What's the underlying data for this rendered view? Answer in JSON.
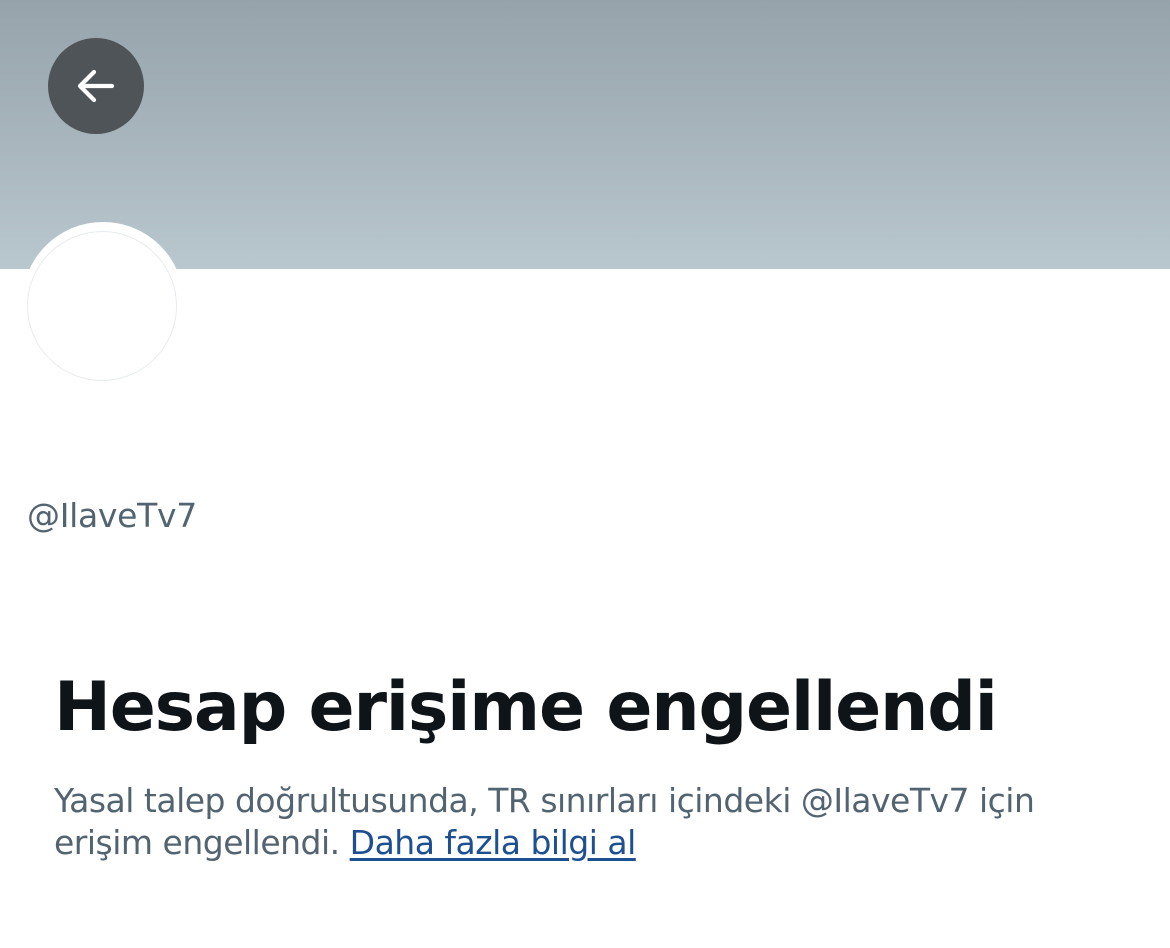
{
  "header": {
    "back_icon": "arrow-left-icon",
    "banner_color": "#a9b6be"
  },
  "profile": {
    "handle": "@IlaveTv7"
  },
  "notice": {
    "title": "Hesap erişime engellendi",
    "body_line1": "Yasal talep doğrultusunda, TR sınırları içindeki @IlaveTv7 için",
    "body_line2": "erişim engellendi.",
    "link_label": "Daha fazla bilgi al",
    "link_color": "#1d4f91"
  }
}
